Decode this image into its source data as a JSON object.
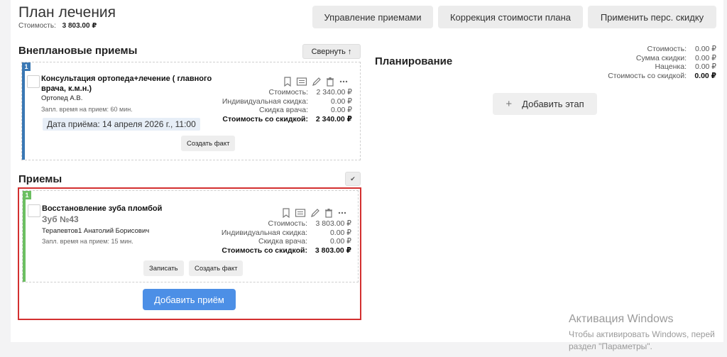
{
  "header": {
    "title": "План лечения",
    "cost_label": "Стоимость:",
    "cost_value": "3 803.00 ₽",
    "buttons": {
      "manage": "Управление приемами",
      "correct": "Коррекция стоимости плана",
      "discount": "Применить перс. скидку"
    }
  },
  "unplanned": {
    "title": "Внеплановые приемы",
    "collapse_label": "Свернуть ↑",
    "card": {
      "number": "1",
      "service_line1": "Консультация ортопеда+лечение ( главного",
      "service_line2": "врача, к.м.н.)",
      "doctor": "Ортопед А.В.",
      "time_note": "Запл. время на прием: 60 мин.",
      "date_chip": "Дата приёма: 14 апреля 2026 г., 11:00",
      "rows": [
        {
          "label": "Стоимость:",
          "value": "2 340.00 ₽"
        },
        {
          "label": "Индивидуальная скидка:",
          "value": "0.00 ₽"
        },
        {
          "label": "Скидка врача:",
          "value": "0.00 ₽"
        },
        {
          "label": "Стоимость со скидкой:",
          "value": "2 340.00 ₽"
        }
      ],
      "create_fact": "Создать факт"
    }
  },
  "appointments": {
    "title": "Приемы",
    "toggle_glyph": "✔",
    "card": {
      "number": "1",
      "service": "Восстановление зуба пломбой",
      "tooth": "Зуб №43",
      "doctor": "Терапевтов1 Анатолий Борисович",
      "time_note": "Запл. время на прием: 15 мин.",
      "rows": [
        {
          "label": "Стоимость:",
          "value": "3 803.00 ₽"
        },
        {
          "label": "Индивидуальная скидка:",
          "value": "0.00 ₽"
        },
        {
          "label": "Скидка врача:",
          "value": "0.00 ₽"
        },
        {
          "label": "Стоимость со скидкой:",
          "value": "3 803.00 ₽"
        }
      ],
      "record": "Записать",
      "create_fact": "Создать факт"
    },
    "add_label": "Добавить приём"
  },
  "planning": {
    "title": "Планирование",
    "rows": [
      {
        "label": "Стоимость:",
        "value": "0.00 ₽"
      },
      {
        "label": "Сумма скидки:",
        "value": "0.00 ₽"
      },
      {
        "label": "Наценка:",
        "value": "0.00 ₽"
      },
      {
        "label": "Стоимость со скидкой:",
        "value": "0.00 ₽"
      }
    ],
    "add_stage_plus": "+",
    "add_stage": "Добавить этап"
  },
  "watermark": {
    "line1": "Активация Windows",
    "line2": "Чтобы активировать Windows, перей",
    "line3": "раздел \"Параметры\"."
  },
  "colors": {
    "unplanned_accent": "#3a78b4",
    "appointment_accent": "#6cbf62",
    "highlight_border": "#d33030",
    "primary_button": "#4c8fe6"
  }
}
